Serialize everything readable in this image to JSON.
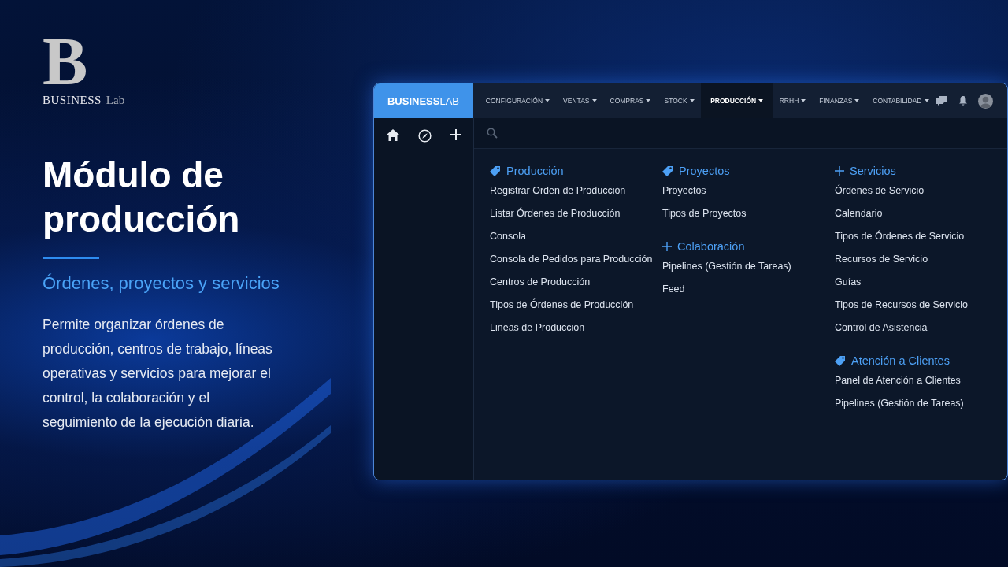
{
  "brand": {
    "letter": "B",
    "name": "BUSINESS",
    "suffix": "Lab"
  },
  "hero": {
    "title": "Módulo de producción",
    "subtitle": "Órdenes, proyectos y servicios",
    "body": "Permite organizar órdenes de producción, centros de trabajo, líneas operativas y servicios para mejorar el control, la colaboración y el seguimiento de la ejecución diaria."
  },
  "app": {
    "logo": {
      "bold": "BUSINESS",
      "light": "LAB"
    },
    "menu": [
      {
        "label": "CONFIGURACIÓN",
        "selected": false
      },
      {
        "label": "VENTAS",
        "selected": false
      },
      {
        "label": "COMPRAS",
        "selected": false
      },
      {
        "label": "STOCK",
        "selected": false
      },
      {
        "label": "PRODUCCIÓN",
        "selected": true
      },
      {
        "label": "RRHH",
        "selected": false
      },
      {
        "label": "FINANZAS",
        "selected": false
      },
      {
        "label": "CONTABILIDAD",
        "selected": false
      }
    ],
    "columns": [
      [
        {
          "kind": "tag",
          "title": "Producción",
          "items": [
            "Registrar Orden de Producción",
            "Listar Órdenes de Producción",
            "Consola",
            "Consola de Pedidos para Producción",
            "Centros de Producción",
            "Tipos de Órdenes de Producción",
            "Lineas de Produccion"
          ]
        }
      ],
      [
        {
          "kind": "tag",
          "title": "Proyectos",
          "items": [
            "Proyectos",
            "Tipos de Proyectos"
          ]
        },
        {
          "kind": "plus",
          "title": "Colaboración",
          "items": [
            "Pipelines (Gestión de Tareas)",
            "Feed"
          ]
        }
      ],
      [
        {
          "kind": "plus",
          "title": "Servicios",
          "items": [
            "Órdenes de Servicio",
            "Calendario",
            "Tipos de Órdenes de Servicio",
            "Recursos de Servicio",
            "Guías",
            "Tipos de Recursos de Servicio",
            "Control de Asistencia"
          ]
        },
        {
          "kind": "tag",
          "title": "Atención a Clientes",
          "items": [
            "Panel de Atención a Clientes",
            "Pipelines (Gestión de Tareas)"
          ]
        }
      ]
    ]
  }
}
